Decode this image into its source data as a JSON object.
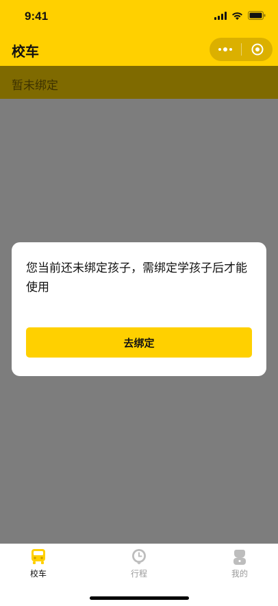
{
  "status_bar": {
    "time": "9:41"
  },
  "nav": {
    "title": "校车"
  },
  "banner": {
    "text": "暂未绑定"
  },
  "modal": {
    "message": "您当前还未绑定孩子，需绑定学孩子后才能使用",
    "button_label": "去绑定"
  },
  "tabs": [
    {
      "label": "校车",
      "icon": "bus-icon",
      "active": true
    },
    {
      "label": "行程",
      "icon": "clock-icon",
      "active": false
    },
    {
      "label": "我的",
      "icon": "person-icon",
      "active": false
    }
  ],
  "colors": {
    "accent": "#ffd000",
    "overlay": "#7d7d7d",
    "banner": "#7f6a00"
  }
}
